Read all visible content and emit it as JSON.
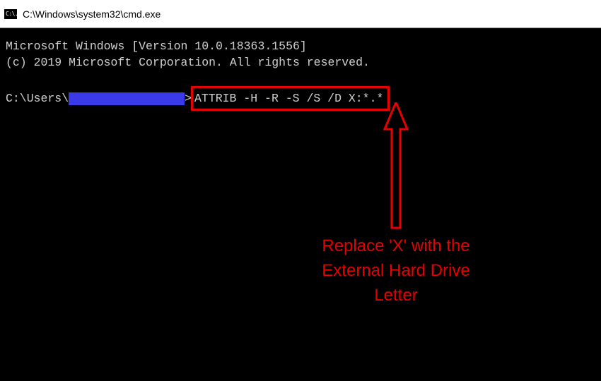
{
  "titlebar": {
    "icon_label": "C:\\.",
    "title": "C:\\Windows\\system32\\cmd.exe"
  },
  "terminal": {
    "line1": "Microsoft Windows [Version 10.0.18363.1556]",
    "line2": "(c) 2019 Microsoft Corporation. All rights reserved.",
    "prompt_prefix": "C:\\Users\\",
    "prompt_suffix": ">",
    "command": "ATTRIB -H -R -S /S /D X:*.*"
  },
  "annotation": {
    "line1": "Replace 'X' with the",
    "line2": "External Hard Drive",
    "line3": "Letter"
  }
}
